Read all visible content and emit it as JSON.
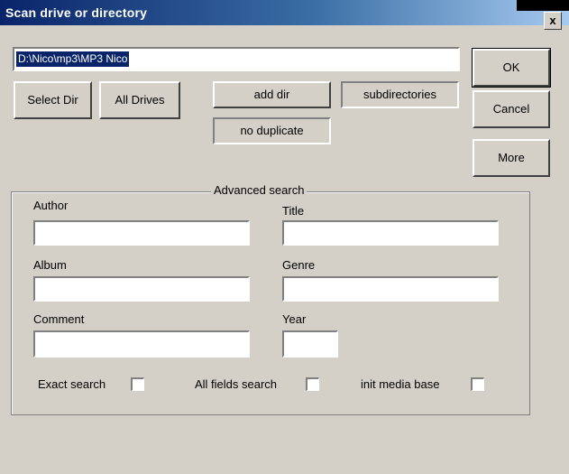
{
  "window": {
    "title": "Scan drive or directory",
    "close_glyph": "x"
  },
  "path_field": {
    "value": "D:\\Nico\\mp3\\MP3 Nico"
  },
  "buttons": {
    "select_dir": "Select Dir",
    "all_drives": "All Drives",
    "add_dir": "add dir",
    "subdirectories": "subdirectories",
    "no_duplicate": "no duplicate",
    "ok": "OK",
    "cancel": "Cancel",
    "more": "More"
  },
  "advanced": {
    "legend": "Advanced search",
    "fields": {
      "author": {
        "label": "Author",
        "value": ""
      },
      "title": {
        "label": "Title",
        "value": ""
      },
      "album": {
        "label": "Album",
        "value": ""
      },
      "genre": {
        "label": "Genre",
        "value": ""
      },
      "comment": {
        "label": "Comment",
        "value": ""
      },
      "year": {
        "label": "Year",
        "value": ""
      }
    },
    "checkboxes": {
      "exact_search": {
        "label": "Exact search",
        "checked": false
      },
      "all_fields_search": {
        "label": "All fields search",
        "checked": false
      },
      "init_media_base": {
        "label": "init media base",
        "checked": false
      }
    }
  }
}
